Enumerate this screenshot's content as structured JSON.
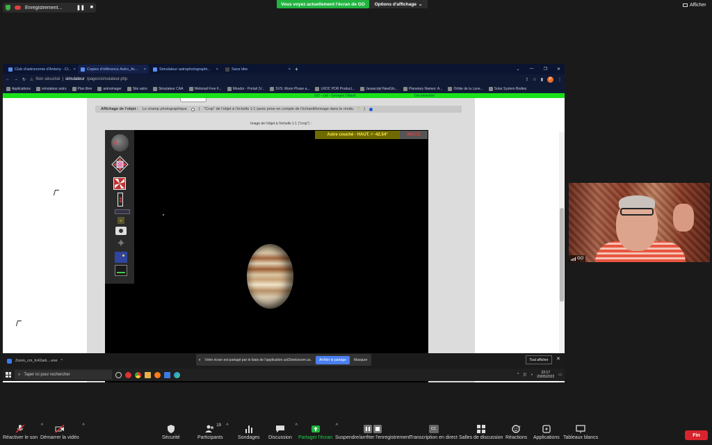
{
  "zoom_top": {
    "recording_label": "Enregistrement...",
    "share_banner": "Vous voyez actuellement l'écran de GO",
    "view_options": "Options d'affichage",
    "view_options_caret": "⌄",
    "afficher": "Afficher",
    "pause_glyph": "❚❚",
    "stop_glyph": "■"
  },
  "browser": {
    "tabs": [
      {
        "label": "Club d'astronomie d'Antony - Cl...",
        "active": false
      },
      {
        "label": "Copies d'référence Astro_Ar...",
        "active": true
      },
      {
        "label": "Simulateur astrophotographi...",
        "active": false
      },
      {
        "label": "Sans titre",
        "active": false
      }
    ],
    "tab_close": "×",
    "new_tab": "+",
    "window_controls": [
      "⌄",
      "—",
      "❐",
      "✕"
    ],
    "security_label": "Non sécurisé",
    "url_host": "simulateur",
    "url_path": "/pages/simulateur.php",
    "profile_initial": "P",
    "bookmarks": [
      "Applications",
      "simulateur astro",
      "Plan libre",
      "astroimager",
      "Site astro",
      "Simulateur CAA",
      "Webmail Free F...",
      "Mirador - Portail (V...",
      "SVS: Moon Phase a...",
      "LROC PDR Product...",
      "Javascript NewGlo...",
      "Planetary Names: A...",
      "Orbite de la Lune...",
      "Solar System Bodies"
    ],
    "green_bar_left": "GO - cnil - Georges Ottavil",
    "green_bar_right": "Déconnexion"
  },
  "page": {
    "options_label": "Affichage de l'objet :",
    "option_field": "Le champ photographique",
    "separator": "|",
    "option_crop": "\"Crop\" de l'objet à l'échelle 1:1 (avec prise en compte de l'échantillonnage dans le rendu",
    "option_crop_hint": "?",
    "option_crop_close": ")",
    "image_caption": "Image de l'objet à l'échelle 1:1 (\"crop\") :",
    "status_astro": "Astre couché - HAUT. = -42.54°",
    "status_imcce": "IMCCE",
    "selected_option": "crop"
  },
  "downloads": {
    "file": "Zoom_cm_fc42ark....exe",
    "caret": "^",
    "zoom_share_message": "Votre écran est partagé par le biais de l'application us02webzoom.us.",
    "stop_share": "Arrêter le partage",
    "hide": "Masquer",
    "show_all": "Tout afficher",
    "close": "✕"
  },
  "taskbar": {
    "search_placeholder": "Taper ici pour rechercher",
    "time": "22:17",
    "date": "20/05/2022",
    "tray_caret": "^"
  },
  "video": {
    "name": "GO"
  },
  "zoom_toolbar": {
    "items": [
      {
        "label": "Réactiver le son",
        "icon": "mic-muted-icon"
      },
      {
        "label": "Démarrer la vidéo",
        "icon": "video-off-icon"
      },
      {
        "label": "Sécurité",
        "icon": "shield-icon"
      },
      {
        "label": "Participants",
        "icon": "participants-icon",
        "count": "19"
      },
      {
        "label": "Sondages",
        "icon": "polls-icon"
      },
      {
        "label": "Discussion",
        "icon": "chat-icon"
      },
      {
        "label": "Partager l'écran",
        "icon": "share-screen-icon"
      },
      {
        "label": "Suspendre/arrêter l'enregistrement",
        "icon": "pause-record-icon"
      },
      {
        "label": "Transcription en direct",
        "icon": "cc-icon"
      },
      {
        "label": "Salles de discussion",
        "icon": "breakout-icon"
      },
      {
        "label": "Réactions",
        "icon": "reactions-icon"
      },
      {
        "label": "Applications",
        "icon": "apps-icon"
      },
      {
        "label": "Tableaux blancs",
        "icon": "whiteboard-icon"
      }
    ],
    "end": "Fin",
    "chevron": "^",
    "cc_glyph": "CC"
  },
  "colors": {
    "share_green": "#21b33f",
    "end_red": "#d8242c",
    "stop_share_blue": "#4a80f0"
  }
}
